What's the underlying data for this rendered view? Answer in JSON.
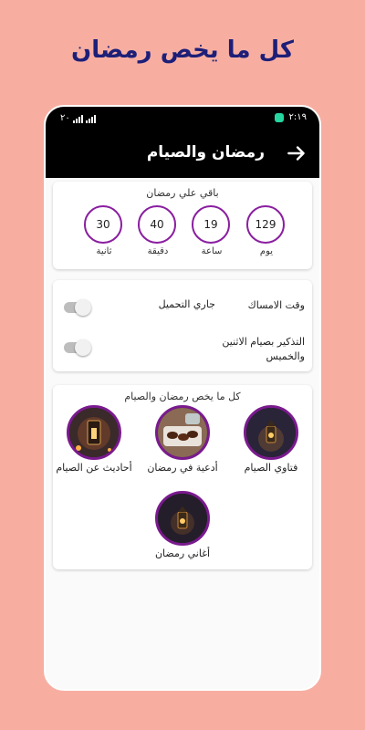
{
  "promo": {
    "title": "كل ما يخص رمضان"
  },
  "status_bar": {
    "time": "٢:١٩",
    "battery": "٢٠"
  },
  "app_bar": {
    "title": "رمضان والصيام",
    "back_icon": "arrow-right-icon"
  },
  "countdown": {
    "heading": "باقي علي رمضان",
    "units": [
      {
        "value": "129",
        "label": "يوم"
      },
      {
        "value": "19",
        "label": "ساعة"
      },
      {
        "value": "40",
        "label": "دقيقة"
      },
      {
        "value": "30",
        "label": "ثانية"
      }
    ]
  },
  "settings": {
    "imsak_label": "وقت الامساك",
    "imsak_status": "جاري التحميل",
    "reminder_label": "التذكير بصيام الاثنين والخميس"
  },
  "features": {
    "heading": "كل ما يخص رمضان والصيام",
    "items": [
      {
        "label": "فتاوي الصيام",
        "icon": "lantern-image"
      },
      {
        "label": "أدعية في رمضان",
        "icon": "dates-image"
      },
      {
        "label": "أحاديث عن الصيام",
        "icon": "candle-lantern-image"
      },
      {
        "label": "أغاني رمضان",
        "icon": "lantern-image"
      }
    ]
  },
  "colors": {
    "background": "#f7aea1",
    "accent": "#8a1fa0",
    "title": "#1d1f78"
  }
}
